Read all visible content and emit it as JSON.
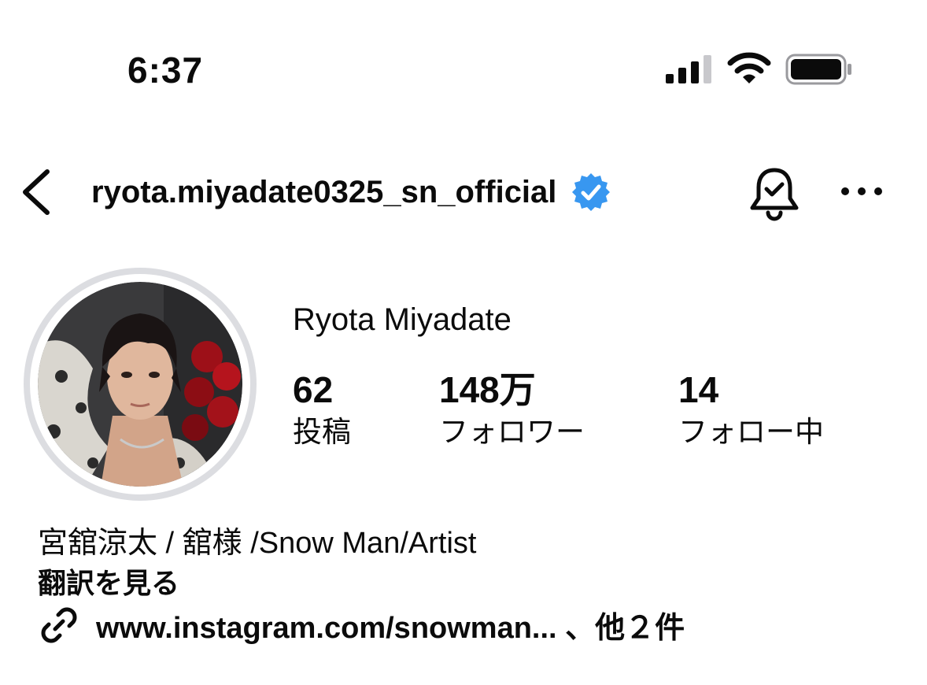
{
  "status_bar": {
    "time": "6:37"
  },
  "header": {
    "username": "ryota.miyadate0325_sn_official",
    "verified_color": "#3897f0"
  },
  "profile": {
    "display_name": "Ryota Miyadate",
    "stats": [
      {
        "count": "62",
        "label": "投稿"
      },
      {
        "count": "148万",
        "label": "フォロワー"
      },
      {
        "count": "14",
        "label": "フォロー中"
      }
    ],
    "bio": "宮舘涼太 / 舘様 /Snow Man/Artist",
    "translate_label": "翻訳を見る",
    "link_text": "www.instagram.com/snowman... 、他２件"
  },
  "icons": {
    "back": "chevron-left-icon",
    "verified": "verified-badge-icon",
    "bell": "notification-bell-icon",
    "more": "more-options-icon",
    "link": "link-icon"
  }
}
